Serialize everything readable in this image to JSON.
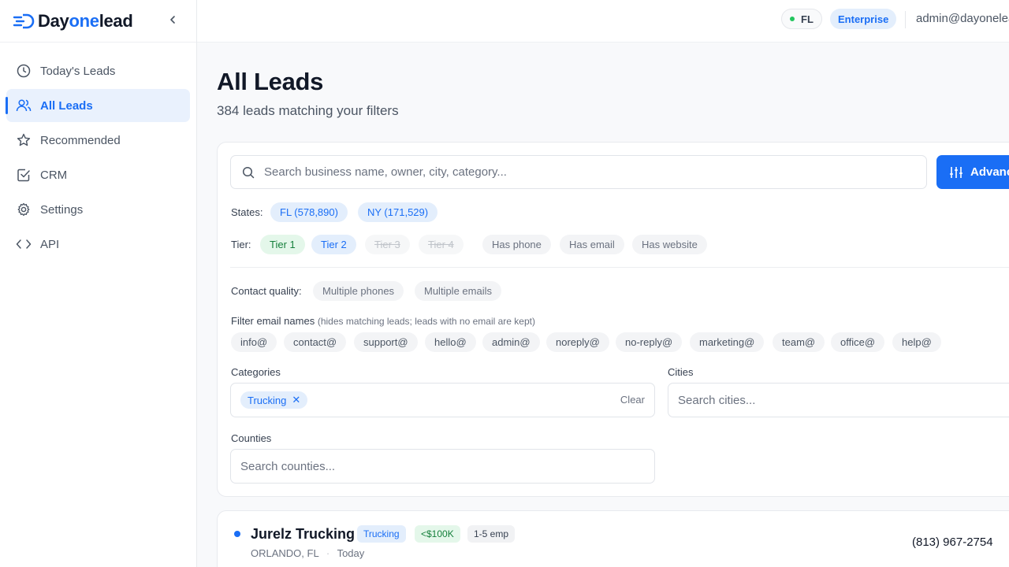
{
  "app": {
    "brand_prefix": "Day",
    "brand_accent": "one",
    "brand_suffix": "lead",
    "accent_color": "#1a6ef5"
  },
  "sidebar": {
    "items": [
      {
        "label": "Today's Leads",
        "icon": "clock-icon",
        "active": false
      },
      {
        "label": "All Leads",
        "icon": "users-icon",
        "active": true
      },
      {
        "label": "Recommended",
        "icon": "star-icon",
        "active": false
      },
      {
        "label": "CRM",
        "icon": "checkbox-icon",
        "active": false
      },
      {
        "label": "Settings",
        "icon": "gear-icon",
        "active": false
      },
      {
        "label": "API",
        "icon": "code-icon",
        "active": false
      }
    ]
  },
  "topbar": {
    "state": "FL",
    "plan": "Enterprise",
    "user_email": "admin@dayonelead"
  },
  "page": {
    "title": "All Leads",
    "subtitle": "384 leads matching your filters"
  },
  "filters": {
    "search_placeholder": "Search business name, owner, city, category...",
    "advanced_label": "Advanced",
    "states_label": "States:",
    "states": [
      "FL (578,890)",
      "NY (171,529)"
    ],
    "tier_label": "Tier:",
    "tiers": [
      {
        "label": "Tier 1",
        "state": "on-green"
      },
      {
        "label": "Tier 2",
        "state": "on-blue"
      },
      {
        "label": "Tier 3",
        "state": "disabled"
      },
      {
        "label": "Tier 4",
        "state": "disabled"
      }
    ],
    "has_filters": [
      "Has phone",
      "Has email",
      "Has website"
    ],
    "contact_quality_label": "Contact quality:",
    "contact_quality": [
      "Multiple phones",
      "Multiple emails"
    ],
    "email_filter_label": "Filter email names",
    "email_filter_hint": "(hides matching leads; leads with no email are kept)",
    "email_names": [
      "info@",
      "contact@",
      "support@",
      "hello@",
      "admin@",
      "noreply@",
      "no-reply@",
      "marketing@",
      "team@",
      "office@",
      "help@"
    ],
    "categories_label": "Categories",
    "categories_selected": [
      "Trucking"
    ],
    "clear_label": "Clear",
    "cities_label": "Cities",
    "cities_placeholder": "Search cities...",
    "counties_label": "Counties",
    "counties_placeholder": "Search counties..."
  },
  "leads": [
    {
      "name": "Jurelz Trucking",
      "category": "Trucking",
      "revenue": "<$100K",
      "employees": "1-5 emp",
      "location": "ORLANDO, FL",
      "separator": "·",
      "added": "Today",
      "phone": "(813) 967-2754"
    }
  ]
}
